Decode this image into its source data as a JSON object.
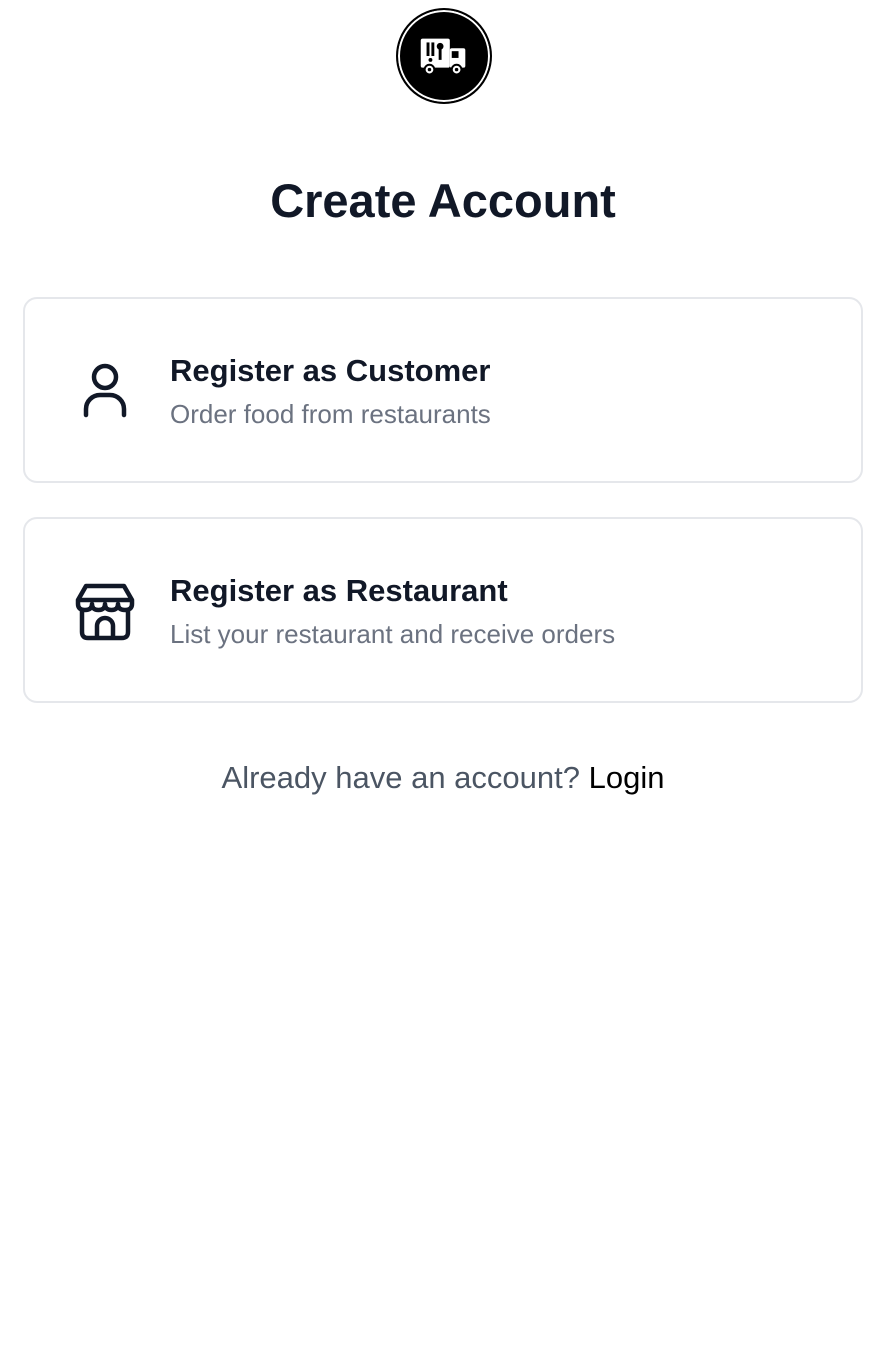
{
  "logo": {
    "icon": "food-truck-icon",
    "background": "#000000"
  },
  "title": "Create Account",
  "options": [
    {
      "icon": "user-icon",
      "title": "Register as Customer",
      "subtitle": "Order food from restaurants"
    },
    {
      "icon": "store-icon",
      "title": "Register as Restaurant",
      "subtitle": "List your restaurant and receive orders"
    }
  ],
  "footer": {
    "prompt": "Already have an account?",
    "login_label": "Login"
  },
  "colors": {
    "text_primary": "#111827",
    "text_secondary": "#6b7280",
    "border": "#e5e7eb"
  }
}
